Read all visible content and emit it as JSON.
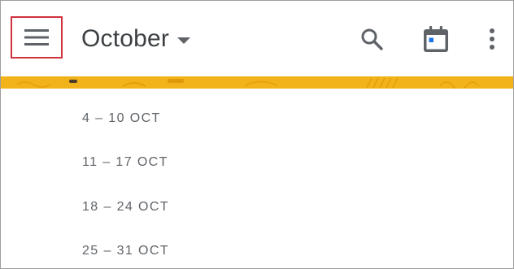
{
  "header": {
    "month_title": "October",
    "icons": {
      "menu": "menu-icon",
      "title_dropdown": "caret-down-icon",
      "search": "search-icon",
      "today": "calendar-today-icon",
      "more": "more-vert-icon"
    }
  },
  "banner": {
    "color": "#f2b219"
  },
  "weeks": [
    {
      "label": "4 – 10 OCT"
    },
    {
      "label": "11 – 17 OCT"
    },
    {
      "label": "18 – 24 OCT"
    },
    {
      "label": "25 – 31 OCT"
    }
  ],
  "colors": {
    "highlight_border": "#d0323e",
    "icon_gray": "#5f6368",
    "text_gray": "#5f6368",
    "today_dot": "#1a73e8"
  }
}
